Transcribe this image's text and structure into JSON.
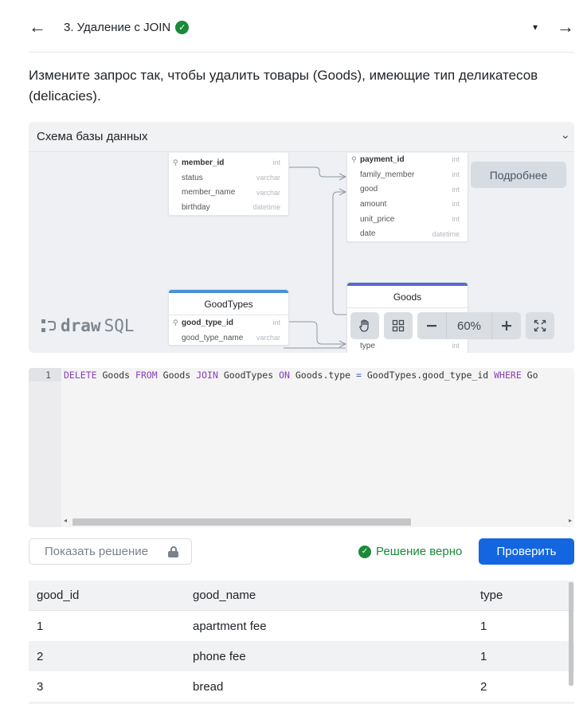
{
  "header": {
    "back_icon": "←",
    "title": "3. Удаление с JOIN",
    "done_icon": "✓",
    "dropdown_icon": "▾",
    "forward_icon": "→"
  },
  "task": {
    "text": "Измените запрос так, чтобы удалить товары (Goods), имеющие тип деликатесов (delicacies)."
  },
  "schema": {
    "title": "Схема базы данных",
    "collapse_icon": "‹",
    "details_button": "Подробнее",
    "logo_left": "draw",
    "logo_right": "SQL",
    "zoom": "60%",
    "tables": {
      "left_top": {
        "rows": [
          {
            "name": "member_id",
            "type": "int",
            "pk": true
          },
          {
            "name": "status",
            "type": "varchar"
          },
          {
            "name": "member_name",
            "type": "varchar"
          },
          {
            "name": "birthday",
            "type": "datetime"
          }
        ]
      },
      "right_top": {
        "rows": [
          {
            "name": "payment_id",
            "type": "int",
            "pk": true
          },
          {
            "name": "family_member",
            "type": "int"
          },
          {
            "name": "good",
            "type": "int"
          },
          {
            "name": "amount",
            "type": "int"
          },
          {
            "name": "unit_price",
            "type": "int"
          },
          {
            "name": "date",
            "type": "datetime"
          }
        ]
      },
      "good_types": {
        "title": "GoodTypes",
        "rows": [
          {
            "name": "good_type_id",
            "type": "int",
            "pk": true
          },
          {
            "name": "good_type_name",
            "type": "varchar"
          }
        ]
      },
      "goods": {
        "title": "Goods",
        "rows": [
          {
            "name": "type",
            "type": "int"
          }
        ]
      }
    }
  },
  "editor": {
    "line_number": "1",
    "tokens": [
      {
        "t": "DELETE",
        "c": "kw"
      },
      {
        "t": " Goods ",
        "c": ""
      },
      {
        "t": "FROM",
        "c": "kw"
      },
      {
        "t": " Goods ",
        "c": ""
      },
      {
        "t": "JOIN",
        "c": "kw"
      },
      {
        "t": " GoodTypes ",
        "c": ""
      },
      {
        "t": "ON",
        "c": "kw"
      },
      {
        "t": " Goods.type ",
        "c": ""
      },
      {
        "t": "=",
        "c": "op"
      },
      {
        "t": " GoodTypes.good_type_id ",
        "c": ""
      },
      {
        "t": "WHERE",
        "c": "kw"
      },
      {
        "t": " Go",
        "c": ""
      }
    ]
  },
  "actions": {
    "show_solution": "Показать решение",
    "status": "Решение верно",
    "check_button": "Проверить"
  },
  "results": {
    "columns": [
      "good_id",
      "good_name",
      "type"
    ],
    "rows": [
      [
        "1",
        "apartment fee",
        "1"
      ],
      [
        "2",
        "phone fee",
        "1"
      ],
      [
        "3",
        "bread",
        "2"
      ]
    ]
  },
  "colors": {
    "accent": "#1466e0",
    "success": "#1b8a3b",
    "good_types_bar": "#4a90d9",
    "goods_bar": "#5b6ad0"
  }
}
